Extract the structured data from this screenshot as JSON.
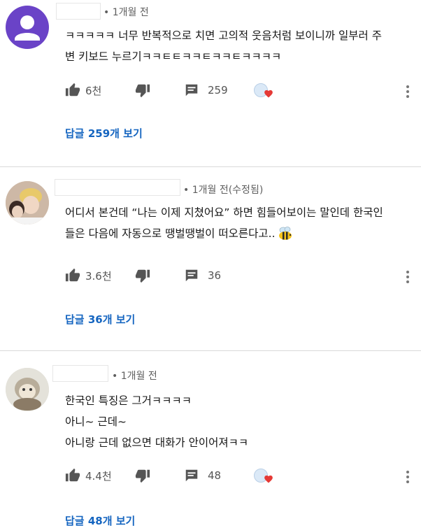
{
  "comments": [
    {
      "time": "1개월 전",
      "lines": [
        "ㅋㅋㅋㅋㅋ 너무 반복적으로 치면 고의적 웃음처럼 보이니까 일부러 주",
        "변 키보드 누르기ㅋㅋㅌㅌㅋㅋㅌㅋㅋㅌㅋㅋㅋㅋ"
      ],
      "likes": "6천",
      "reply_count": "259",
      "view_replies": "답글 259개 보기",
      "creator_heart": true
    },
    {
      "time": "1개월 전(수정됨)",
      "lines": [
        "어디서 본건데 “나는 이제 지쳤어요” 하면 힘들어보이는 말인데 한국인",
        "들은 다음에 자동으로 땡벌땡벌이 떠오른다고.."
      ],
      "likes": "3.6천",
      "reply_count": "36",
      "view_replies": "답글 36개 보기",
      "creator_heart": false
    },
    {
      "time": "1개월 전",
      "lines": [
        "한국인 특징은 그거ㅋㅋㅋㅋ",
        "아니~ 근데~",
        "아니랑 근데 없으면 대화가 안이어져ㅋㅋ"
      ],
      "likes": "4.4천",
      "reply_count": "48",
      "view_replies": "답글 48개 보기",
      "creator_heart": true
    }
  ],
  "icons": {
    "like": "thumb-up-icon",
    "dislike": "thumb-down-icon",
    "reply": "comment-icon",
    "more": "more-vert-icon",
    "heart": "creator-heart-icon",
    "bee": "bee-emoji"
  },
  "colors": {
    "link": "#1565c0",
    "meta": "#5f5f5f",
    "heart": "#e53935",
    "avatar_default": "#6a43c7"
  }
}
